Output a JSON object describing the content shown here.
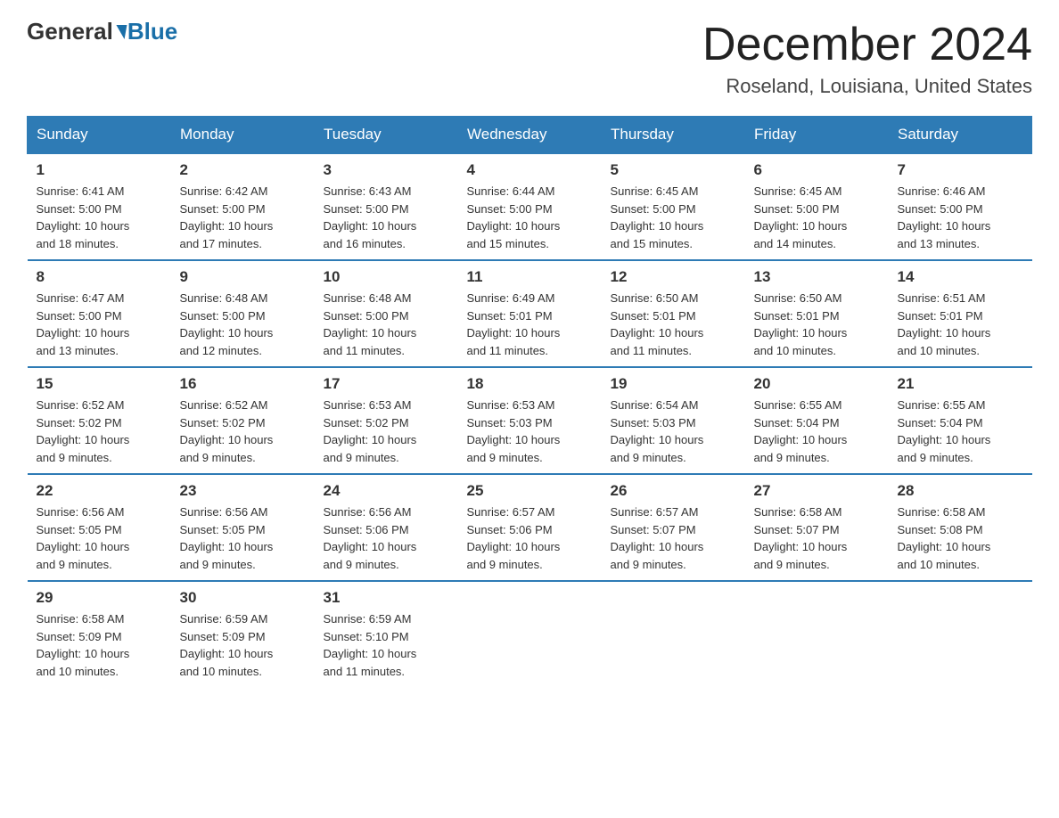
{
  "header": {
    "logo_general": "General",
    "logo_blue": "Blue",
    "month_title": "December 2024",
    "location": "Roseland, Louisiana, United States"
  },
  "days_of_week": [
    "Sunday",
    "Monday",
    "Tuesday",
    "Wednesday",
    "Thursday",
    "Friday",
    "Saturday"
  ],
  "weeks": [
    [
      {
        "day": "1",
        "sunrise": "6:41 AM",
        "sunset": "5:00 PM",
        "daylight": "10 hours and 18 minutes."
      },
      {
        "day": "2",
        "sunrise": "6:42 AM",
        "sunset": "5:00 PM",
        "daylight": "10 hours and 17 minutes."
      },
      {
        "day": "3",
        "sunrise": "6:43 AM",
        "sunset": "5:00 PM",
        "daylight": "10 hours and 16 minutes."
      },
      {
        "day": "4",
        "sunrise": "6:44 AM",
        "sunset": "5:00 PM",
        "daylight": "10 hours and 15 minutes."
      },
      {
        "day": "5",
        "sunrise": "6:45 AM",
        "sunset": "5:00 PM",
        "daylight": "10 hours and 15 minutes."
      },
      {
        "day": "6",
        "sunrise": "6:45 AM",
        "sunset": "5:00 PM",
        "daylight": "10 hours and 14 minutes."
      },
      {
        "day": "7",
        "sunrise": "6:46 AM",
        "sunset": "5:00 PM",
        "daylight": "10 hours and 13 minutes."
      }
    ],
    [
      {
        "day": "8",
        "sunrise": "6:47 AM",
        "sunset": "5:00 PM",
        "daylight": "10 hours and 13 minutes."
      },
      {
        "day": "9",
        "sunrise": "6:48 AM",
        "sunset": "5:00 PM",
        "daylight": "10 hours and 12 minutes."
      },
      {
        "day": "10",
        "sunrise": "6:48 AM",
        "sunset": "5:00 PM",
        "daylight": "10 hours and 11 minutes."
      },
      {
        "day": "11",
        "sunrise": "6:49 AM",
        "sunset": "5:01 PM",
        "daylight": "10 hours and 11 minutes."
      },
      {
        "day": "12",
        "sunrise": "6:50 AM",
        "sunset": "5:01 PM",
        "daylight": "10 hours and 11 minutes."
      },
      {
        "day": "13",
        "sunrise": "6:50 AM",
        "sunset": "5:01 PM",
        "daylight": "10 hours and 10 minutes."
      },
      {
        "day": "14",
        "sunrise": "6:51 AM",
        "sunset": "5:01 PM",
        "daylight": "10 hours and 10 minutes."
      }
    ],
    [
      {
        "day": "15",
        "sunrise": "6:52 AM",
        "sunset": "5:02 PM",
        "daylight": "10 hours and 9 minutes."
      },
      {
        "day": "16",
        "sunrise": "6:52 AM",
        "sunset": "5:02 PM",
        "daylight": "10 hours and 9 minutes."
      },
      {
        "day": "17",
        "sunrise": "6:53 AM",
        "sunset": "5:02 PM",
        "daylight": "10 hours and 9 minutes."
      },
      {
        "day": "18",
        "sunrise": "6:53 AM",
        "sunset": "5:03 PM",
        "daylight": "10 hours and 9 minutes."
      },
      {
        "day": "19",
        "sunrise": "6:54 AM",
        "sunset": "5:03 PM",
        "daylight": "10 hours and 9 minutes."
      },
      {
        "day": "20",
        "sunrise": "6:55 AM",
        "sunset": "5:04 PM",
        "daylight": "10 hours and 9 minutes."
      },
      {
        "day": "21",
        "sunrise": "6:55 AM",
        "sunset": "5:04 PM",
        "daylight": "10 hours and 9 minutes."
      }
    ],
    [
      {
        "day": "22",
        "sunrise": "6:56 AM",
        "sunset": "5:05 PM",
        "daylight": "10 hours and 9 minutes."
      },
      {
        "day": "23",
        "sunrise": "6:56 AM",
        "sunset": "5:05 PM",
        "daylight": "10 hours and 9 minutes."
      },
      {
        "day": "24",
        "sunrise": "6:56 AM",
        "sunset": "5:06 PM",
        "daylight": "10 hours and 9 minutes."
      },
      {
        "day": "25",
        "sunrise": "6:57 AM",
        "sunset": "5:06 PM",
        "daylight": "10 hours and 9 minutes."
      },
      {
        "day": "26",
        "sunrise": "6:57 AM",
        "sunset": "5:07 PM",
        "daylight": "10 hours and 9 minutes."
      },
      {
        "day": "27",
        "sunrise": "6:58 AM",
        "sunset": "5:07 PM",
        "daylight": "10 hours and 9 minutes."
      },
      {
        "day": "28",
        "sunrise": "6:58 AM",
        "sunset": "5:08 PM",
        "daylight": "10 hours and 10 minutes."
      }
    ],
    [
      {
        "day": "29",
        "sunrise": "6:58 AM",
        "sunset": "5:09 PM",
        "daylight": "10 hours and 10 minutes."
      },
      {
        "day": "30",
        "sunrise": "6:59 AM",
        "sunset": "5:09 PM",
        "daylight": "10 hours and 10 minutes."
      },
      {
        "day": "31",
        "sunrise": "6:59 AM",
        "sunset": "5:10 PM",
        "daylight": "10 hours and 11 minutes."
      },
      null,
      null,
      null,
      null
    ]
  ],
  "labels": {
    "sunrise": "Sunrise:",
    "sunset": "Sunset:",
    "daylight": "Daylight:"
  }
}
